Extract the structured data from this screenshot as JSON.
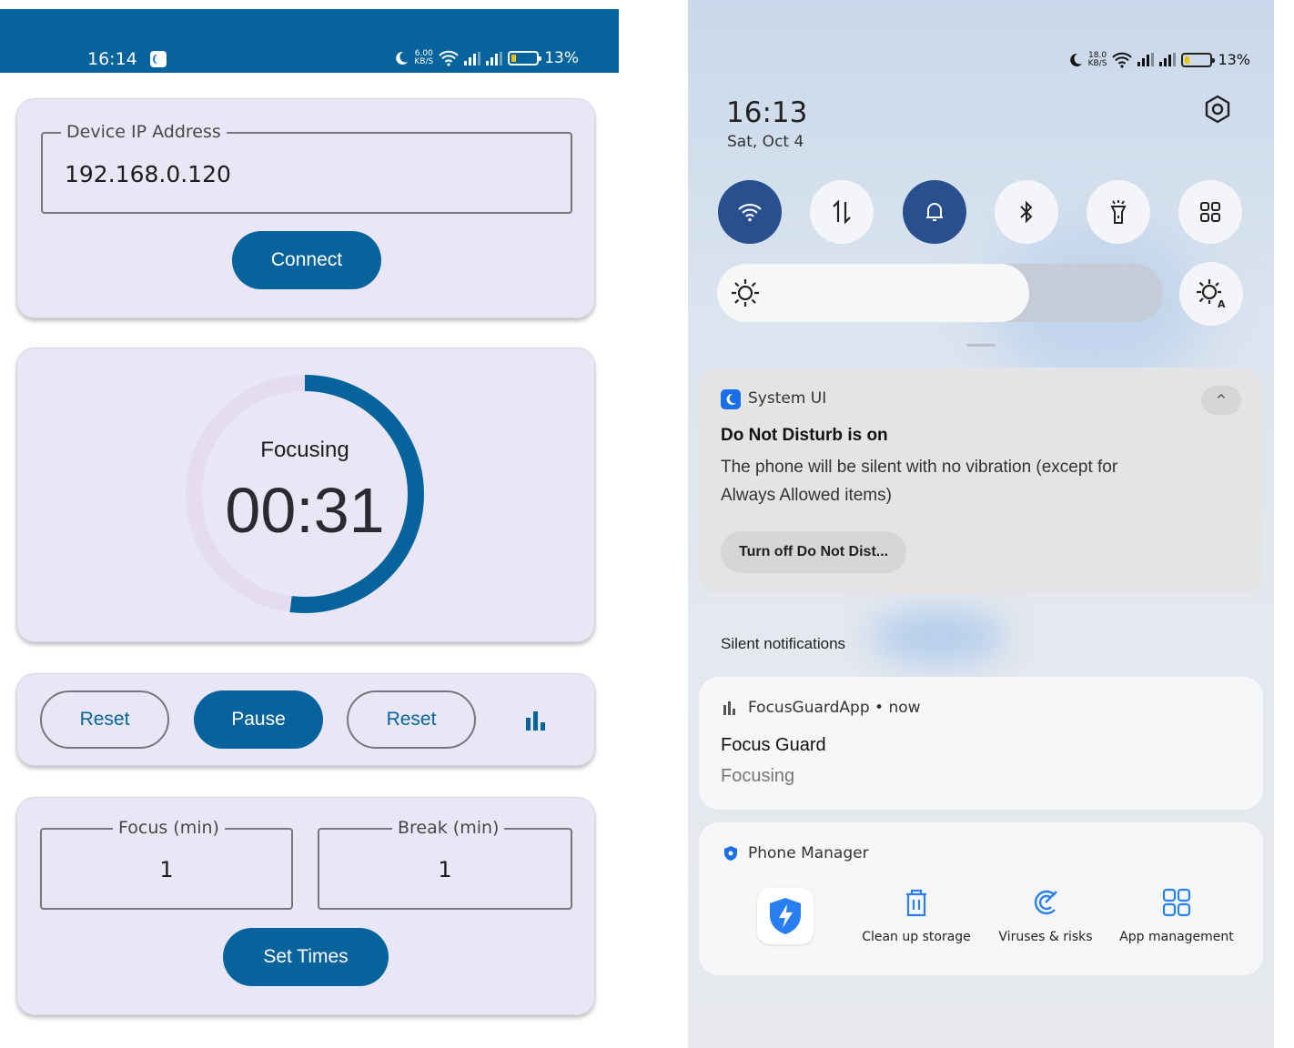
{
  "left_screen": {
    "status_bar": {
      "time": "16:14",
      "speed_top": "6.00",
      "speed_bottom": "KB/S",
      "battery": "13%",
      "bg_color": "#07639c"
    },
    "connection": {
      "ip_label": "Device IP Address",
      "ip_value": "192.168.0.120",
      "connect_label": "Connect"
    },
    "timer": {
      "state": "Focusing",
      "time": "00:31",
      "progress_fraction": 0.52,
      "accent": "#07639c",
      "track_color": "#e4ddf2"
    },
    "controls": {
      "reset_left": "Reset",
      "pause": "Pause",
      "reset_right": "Reset",
      "stats_icon": "bar-chart-icon"
    },
    "settings": {
      "focus_label": "Focus (min)",
      "focus_value": "1",
      "break_label": "Break (min)",
      "break_value": "1",
      "set_label": "Set Times"
    }
  },
  "right_screen": {
    "status_bar": {
      "speed_top": "18.0",
      "speed_bottom": "KB/S",
      "battery": "13%"
    },
    "quick_settings": {
      "time": "16:13",
      "date": "Sat, Oct 4",
      "tiles": [
        {
          "name": "wifi-icon",
          "on": true
        },
        {
          "name": "mobile-data-icon",
          "on": false
        },
        {
          "name": "bell-icon",
          "on": true
        },
        {
          "name": "bluetooth-icon",
          "on": false
        },
        {
          "name": "flashlight-icon",
          "on": false
        },
        {
          "name": "grid-icon",
          "on": false
        }
      ],
      "brightness_fraction": 0.7
    },
    "dnd_notification": {
      "app": "System UI",
      "title": "Do Not Disturb is on",
      "body_line1": "The phone will be silent with no vibration (except for",
      "body_line2": "Always Allowed items)",
      "action": "Turn off Do Not Dist..."
    },
    "silent_header": "Silent notifications",
    "focus_notification": {
      "app": "FocusGuardApp",
      "separator": "•",
      "when": "now",
      "title": "Focus Guard",
      "body": "Focusing"
    },
    "phone_manager": {
      "app": "Phone Manager",
      "items": [
        {
          "label": "Clean up storage",
          "icon": "trash-icon"
        },
        {
          "label": "Viruses & risks",
          "icon": "virus-scan-icon"
        },
        {
          "label": "App management",
          "icon": "app-grid-icon"
        }
      ]
    }
  }
}
